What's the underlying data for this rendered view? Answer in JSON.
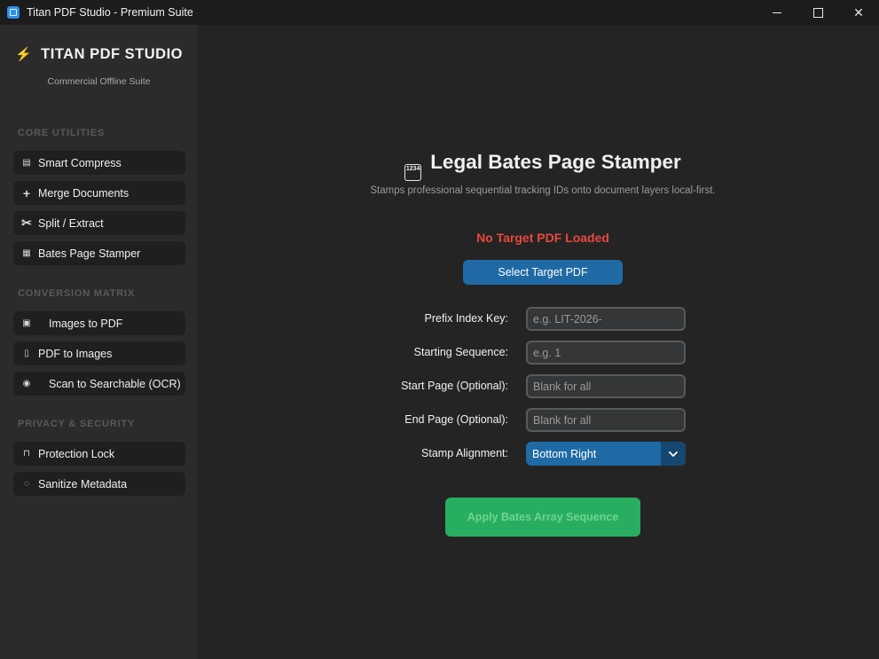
{
  "window": {
    "title": "Titan PDF Studio - Premium Suite",
    "controls": {
      "minimize": "minimize",
      "maximize": "maximize",
      "close": "✕"
    }
  },
  "sidebar": {
    "brand_icon": "⚡",
    "brand": "TITAN PDF STUDIO",
    "brand_sub": "Commercial Offline Suite",
    "sections": [
      {
        "title": "CORE UTILITIES",
        "items": [
          {
            "icon": "compress-icon",
            "glyph": "▤",
            "label": "Smart Compress"
          },
          {
            "icon": "plus-icon",
            "glyph": "+",
            "label": "Merge Documents"
          },
          {
            "icon": "scissors-icon",
            "glyph": "✂",
            "label": "Split / Extract"
          },
          {
            "icon": "numbers-icon",
            "glyph": "▦",
            "label": "Bates Page Stamper"
          }
        ]
      },
      {
        "title": "CONVERSION MATRIX",
        "items": [
          {
            "icon": "image-icon",
            "glyph": "▣",
            "label": "Images to PDF"
          },
          {
            "icon": "document-icon",
            "glyph": "▯",
            "label": "PDF to Images"
          },
          {
            "icon": "eye-icon",
            "glyph": "◉",
            "label": "Scan to Searchable (OCR)"
          }
        ]
      },
      {
        "title": "PRIVACY & SECURITY",
        "items": [
          {
            "icon": "lock-icon",
            "glyph": "⊓",
            "label": "Protection Lock"
          },
          {
            "icon": "sanitize-icon",
            "glyph": "◌",
            "label": "Sanitize Metadata"
          }
        ]
      }
    ]
  },
  "main": {
    "heading_icon": "1234",
    "heading": "Legal Bates Page Stamper",
    "subtitle": "Stamps professional sequential tracking IDs onto document layers local-first.",
    "status": "No Target PDF Loaded",
    "select_button": "Select Target PDF",
    "form": {
      "prefix_label": "Prefix Index Key:",
      "prefix_placeholder": "e.g. LIT-2026-",
      "start_seq_label": "Starting Sequence:",
      "start_seq_placeholder": "e.g. 1",
      "start_page_label": "Start Page (Optional):",
      "start_page_placeholder": "Blank for all",
      "end_page_label": "End Page (Optional):",
      "end_page_placeholder": "Blank for all",
      "alignment_label": "Stamp Alignment:",
      "alignment_value": "Bottom Right"
    },
    "apply_button": "Apply Bates Array Sequence"
  },
  "colors": {
    "accent": "#1f6aa5",
    "success": "#27ae60",
    "error": "#e8483d",
    "sidebar_bg": "#2b2b2b",
    "main_bg": "#242424"
  }
}
